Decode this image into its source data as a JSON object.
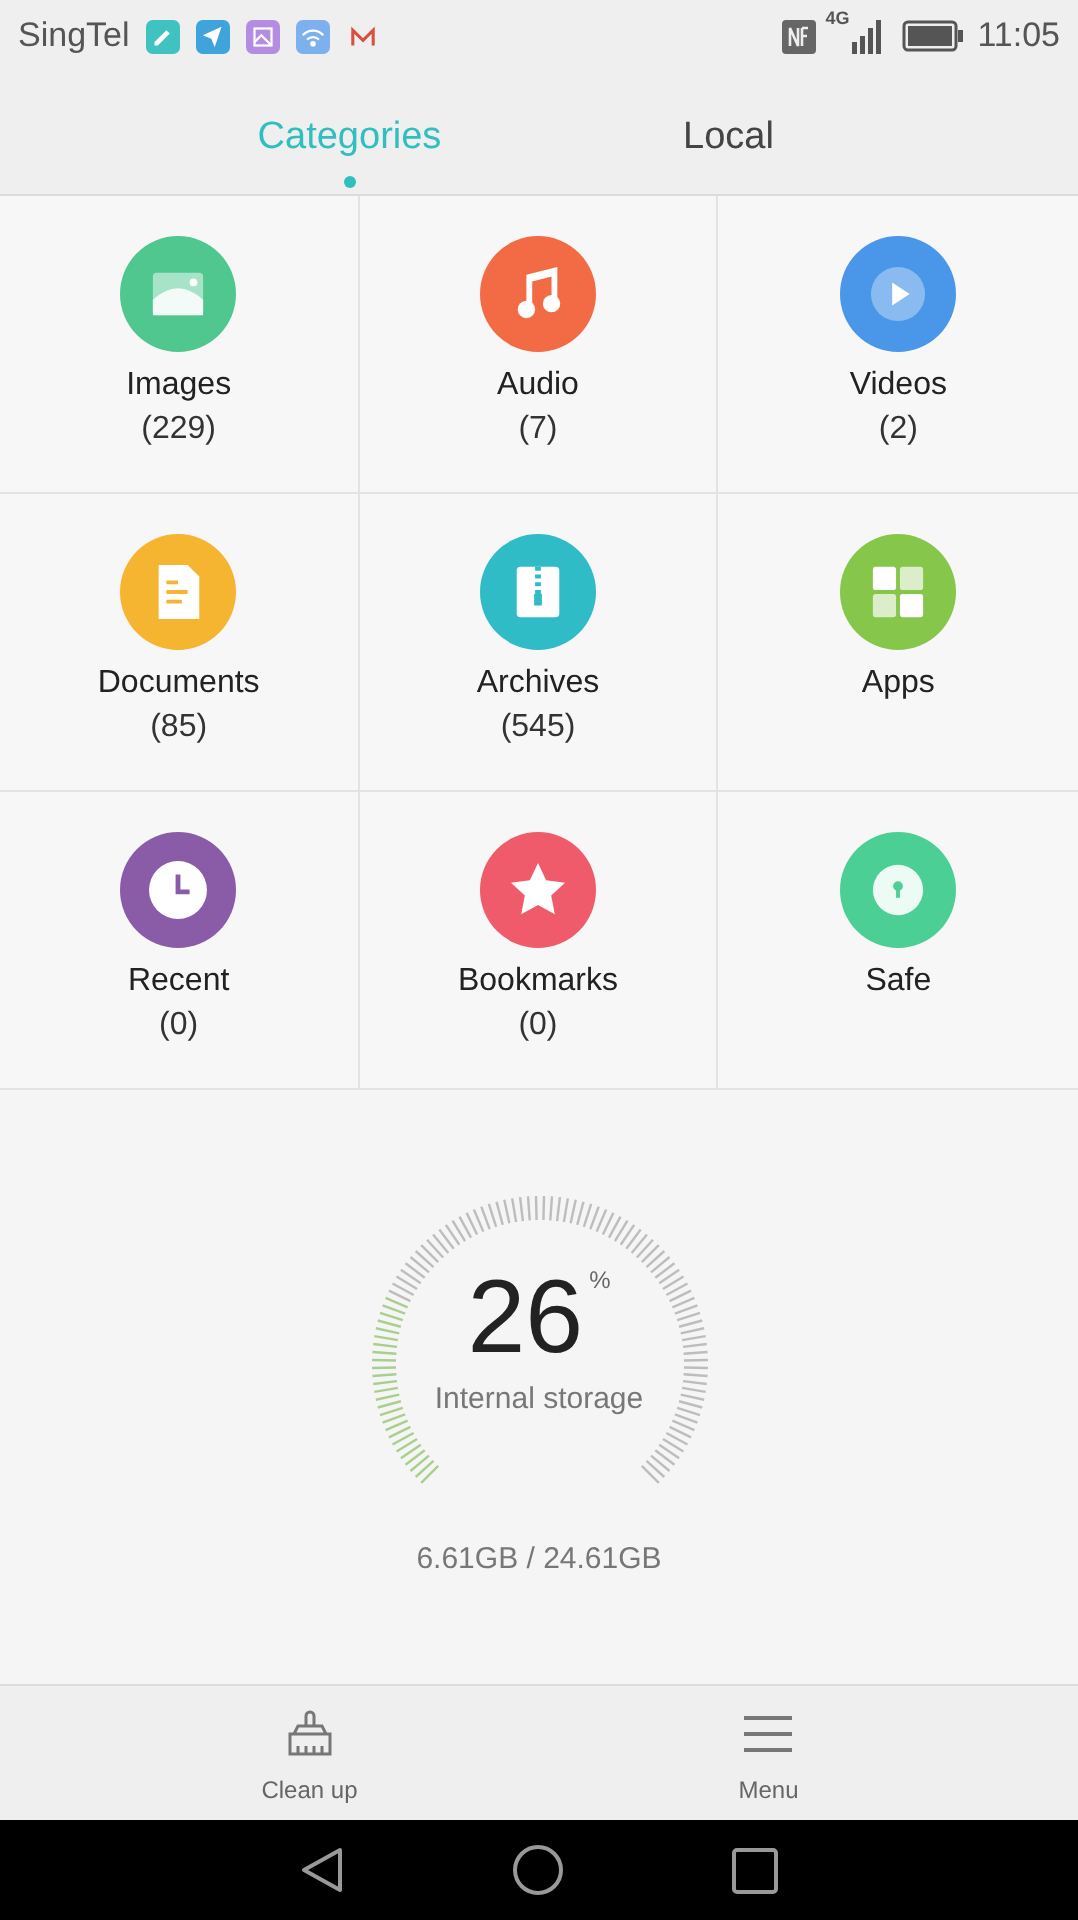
{
  "status_bar": {
    "carrier": "SingTel",
    "network": "4G",
    "time": "11:05",
    "notifications": [
      {
        "kind": "edit",
        "color": "#3fc2c0"
      },
      {
        "kind": "send",
        "color": "#3fa3dc"
      },
      {
        "kind": "image",
        "color": "#b58de0"
      },
      {
        "kind": "wifi",
        "color": "#7fb0ee"
      },
      {
        "kind": "mail",
        "color": "#d9503f"
      }
    ]
  },
  "tabs": [
    {
      "label": "Categories",
      "selected": true
    },
    {
      "label": "Local",
      "selected": false
    }
  ],
  "categories": [
    {
      "kind": "images",
      "label": "Images",
      "count": "(229)",
      "color": "#4fc78e"
    },
    {
      "kind": "audio",
      "label": "Audio",
      "count": "(7)",
      "color": "#f26b45"
    },
    {
      "kind": "videos",
      "label": "Videos",
      "count": "(2)",
      "color": "#4a97ea"
    },
    {
      "kind": "documents",
      "label": "Documents",
      "count": "(85)",
      "color": "#f6b531"
    },
    {
      "kind": "archives",
      "label": "Archives",
      "count": "(545)",
      "color": "#2fbcc6"
    },
    {
      "kind": "apps",
      "label": "Apps",
      "color": "#86c64a"
    },
    {
      "kind": "recent",
      "label": "Recent",
      "count": "(0)",
      "color": "#8a5ca8"
    },
    {
      "kind": "bookmarks",
      "label": "Bookmarks",
      "count": "(0)",
      "color": "#ef5b6b"
    },
    {
      "kind": "safe",
      "label": "Safe",
      "color": "#4ccf94"
    }
  ],
  "storage": {
    "percent": "26",
    "unit": "%",
    "label": "Internal storage",
    "usage": "6.61GB / 24.61GB"
  },
  "bottom_bar": [
    {
      "kind": "clean",
      "label": "Clean up"
    },
    {
      "kind": "menu",
      "label": "Menu"
    }
  ]
}
